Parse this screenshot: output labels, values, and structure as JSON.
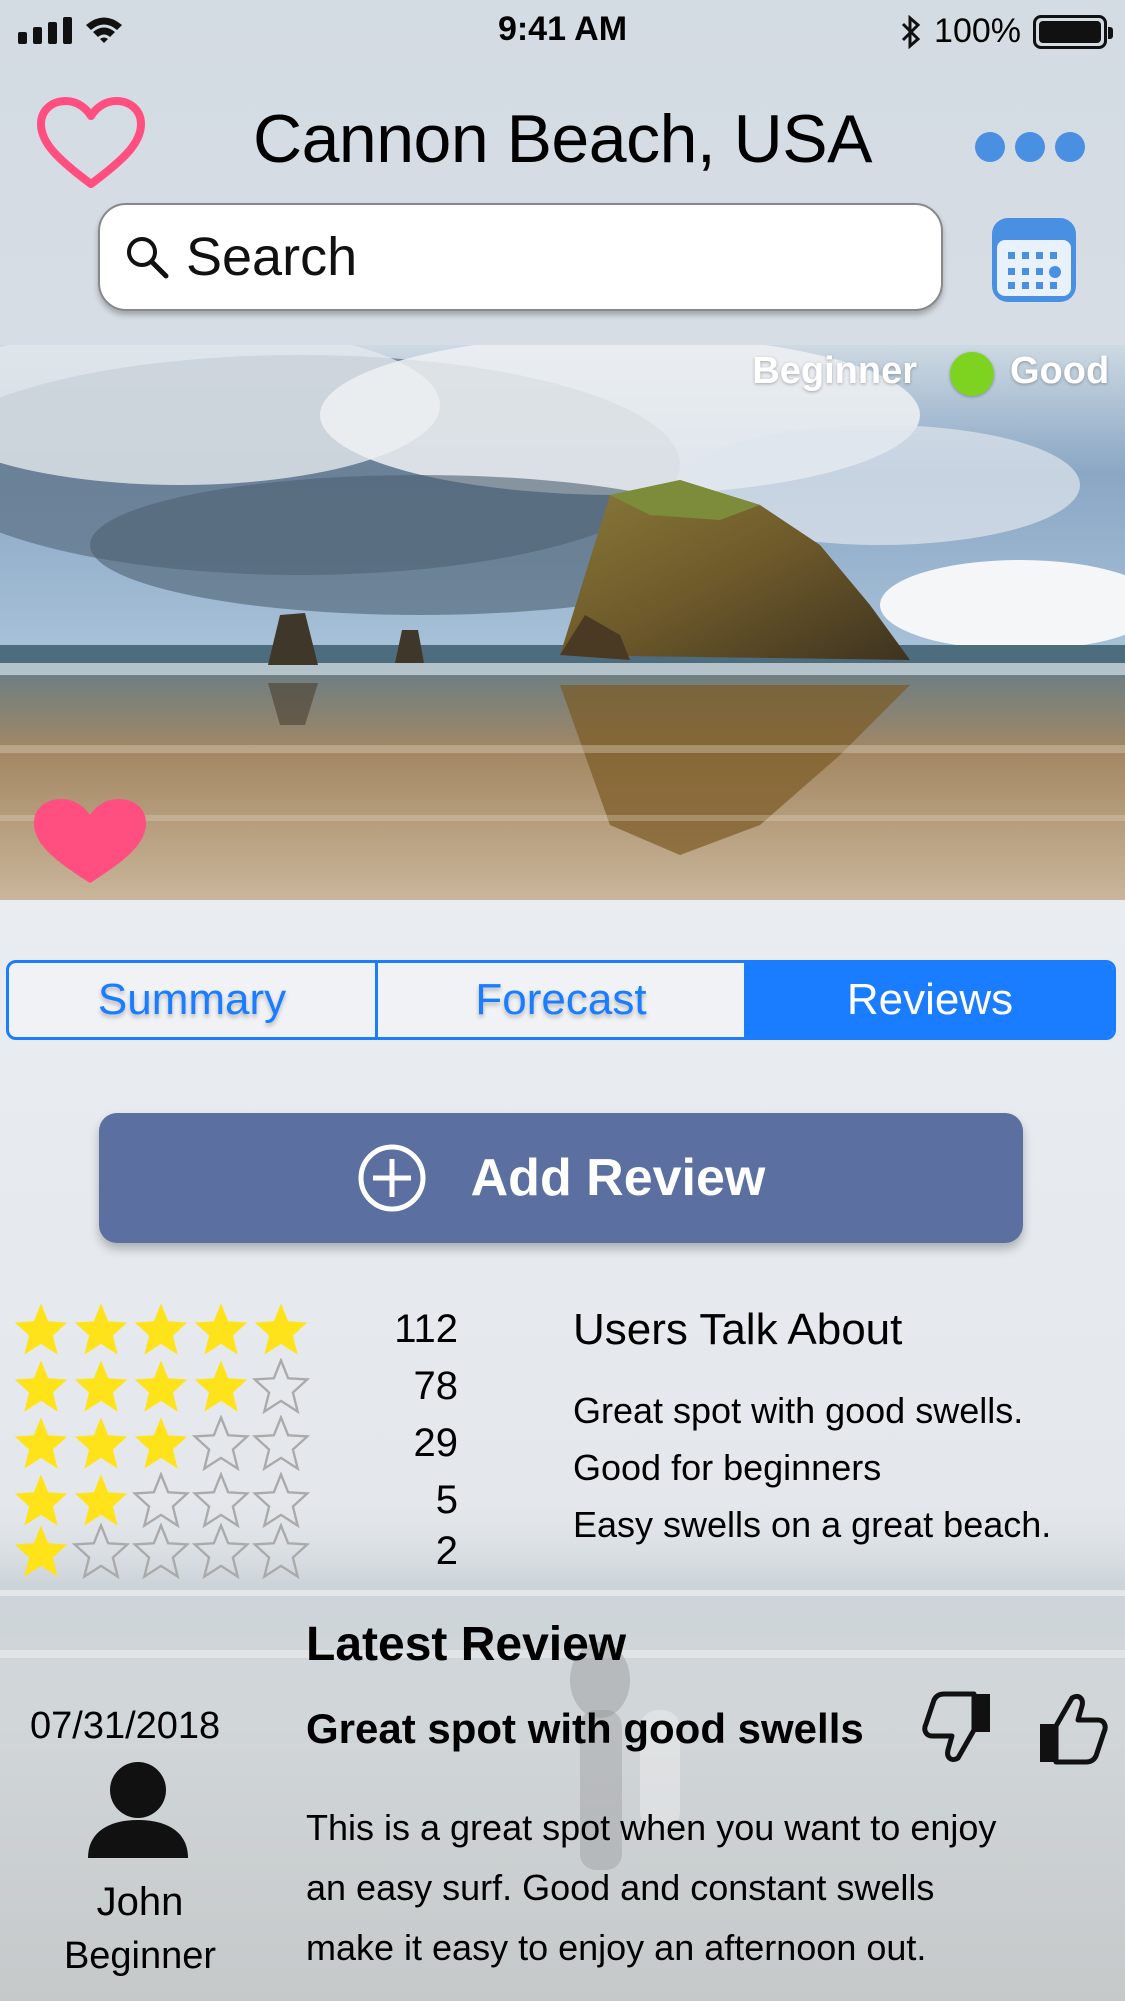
{
  "status_bar": {
    "time": "9:41 AM",
    "battery": "100%",
    "battery_level": 1.0,
    "icons": [
      "signal-icon",
      "wifi-icon",
      "bluetooth-icon",
      "battery-icon"
    ]
  },
  "header": {
    "title": "Cannon Beach, USA",
    "favorite_icon": "heart-outline-icon",
    "more_icon": "more-dots-icon"
  },
  "search": {
    "placeholder": "Search",
    "icon": "search-icon"
  },
  "calendar": {
    "icon": "calendar-icon"
  },
  "hero": {
    "level": "Beginner",
    "condition": "Good",
    "condition_color": "#7ed321",
    "favorite_icon": "heart-filled-icon"
  },
  "tabs": [
    {
      "label": "Summary",
      "active": false
    },
    {
      "label": "Forecast",
      "active": false
    },
    {
      "label": "Reviews",
      "active": true
    }
  ],
  "add_review": {
    "label": "Add Review",
    "icon": "plus-circle-icon"
  },
  "ratings": [
    {
      "stars": 5,
      "count": "112"
    },
    {
      "stars": 4,
      "count": "78"
    },
    {
      "stars": 3,
      "count": "29"
    },
    {
      "stars": 2,
      "count": "5"
    },
    {
      "stars": 1,
      "count": "2"
    }
  ],
  "users_talk": {
    "title": "Users Talk About",
    "items": [
      "Great spot with good swells.",
      "Good for beginners",
      "Easy swells on a great beach."
    ]
  },
  "latest_review": {
    "section_title": "Latest Review",
    "date": "07/31/2018",
    "headline": "Great spot with good swells",
    "reviewer_name": "John",
    "reviewer_level": "Beginner",
    "body_lines": [
      "This is a great spot when you want to enjoy",
      "an easy surf. Good and constant  swells",
      "make it easy to enjoy an afternoon out."
    ]
  },
  "colors": {
    "accent": "#1a7cff",
    "heart": "#ff4f81",
    "button": "#5b6fa0",
    "star": "#ffe31a",
    "dots": "#4a90e2"
  }
}
